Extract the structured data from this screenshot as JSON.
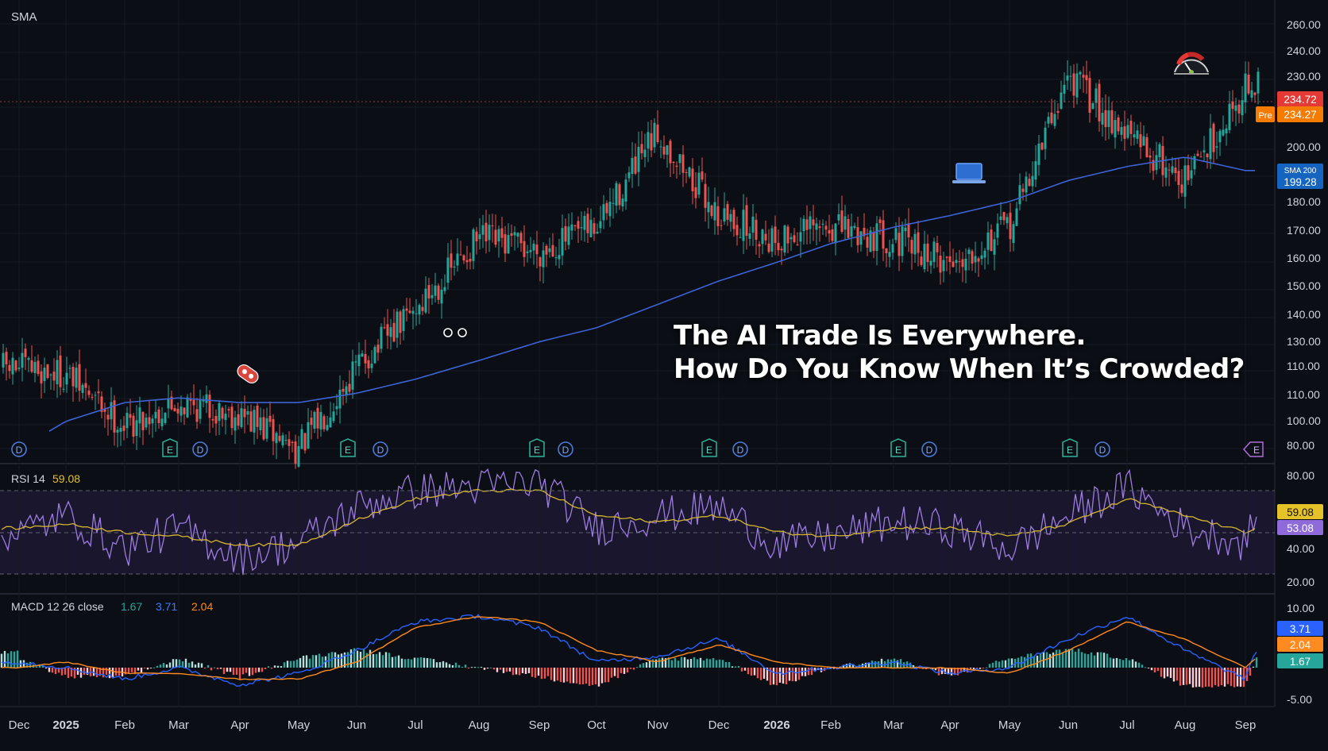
{
  "headline": {
    "line1": "The AI Trade Is Everywhere.",
    "line2": "How Do You Know When It’s Crowded?"
  },
  "price_pane": {
    "indicator_label": "SMA",
    "price_badge": "234.72",
    "pre_label": "Pre",
    "pre_badge": "234.27",
    "sma_label": "SMA 200",
    "sma_value": "199.28",
    "markers_d": [
      "D",
      "D",
      "D",
      "D",
      "D",
      "D",
      "D"
    ],
    "markers_e": [
      "E",
      "E",
      "E",
      "E",
      "E",
      "E",
      "E"
    ]
  },
  "rsi_pane": {
    "label": "RSI 14",
    "value": "59.08",
    "badge_rsi": "59.08",
    "badge_ma": "53.08"
  },
  "macd_pane": {
    "label": "MACD 12 26 close",
    "hist": "1.67",
    "macd": "3.71",
    "signal": "2.04",
    "badge_macd": "3.71",
    "badge_signal": "2.04",
    "badge_hist": "1.67"
  },
  "colors": {
    "background": "#0b0e14",
    "up": "#26a69a",
    "down": "#ef5350",
    "sma": "#3d63d6",
    "rsi": "#9c7de0",
    "rsi_ma": "#d4b530",
    "macd": "#2962ff",
    "signal": "#ff8a1f",
    "price_badge": "#e53935",
    "pre_badge": "#f57c00",
    "sma_badge": "#1565c0"
  },
  "icons": [
    "gauge-icon",
    "laptop-icon",
    "pill-icon"
  ],
  "chart_data": [
    {
      "type": "candlestick",
      "pane": "price",
      "x_axis": [
        "Dec",
        "2025",
        "Feb",
        "Mar",
        "Apr",
        "May",
        "Jun",
        "Jul",
        "Aug",
        "Sep",
        "Oct",
        "Nov",
        "Dec",
        "2026",
        "Feb",
        "Mar",
        "Apr",
        "May",
        "Jun",
        "Jul",
        "Aug",
        "Sep"
      ],
      "y_ticks": [
        "260.00",
        "240.00",
        "230.00",
        "200.00",
        "180.00",
        "170.00",
        "160.00",
        "150.00",
        "140.00",
        "130.00",
        "110.00",
        "110.00",
        "100.00",
        "80.00"
      ],
      "approx_close_by_month": [
        115,
        112,
        90,
        100,
        95,
        80,
        115,
        140,
        170,
        165,
        175,
        215,
        180,
        170,
        175,
        170,
        160,
        175,
        240,
        215,
        195,
        234.72
      ],
      "sma200_by_month": [
        80,
        92,
        100,
        102,
        100,
        100,
        104,
        110,
        118,
        126,
        132,
        142,
        152,
        160,
        168,
        175,
        180,
        186,
        195,
        201,
        205,
        199.28
      ]
    },
    {
      "type": "line",
      "pane": "rsi",
      "y_ticks": [
        "80.00",
        "40.00",
        "20.00"
      ],
      "bands": [
        70,
        30
      ],
      "series": [
        {
          "name": "RSI 14",
          "values": [
            50,
            58,
            42,
            52,
            38,
            45,
            62,
            70,
            72,
            74,
            52,
            58,
            62,
            44,
            48,
            55,
            52,
            42,
            58,
            72,
            52,
            45,
            59.08
          ]
        },
        {
          "name": "MA",
          "values": [
            52,
            54,
            50,
            48,
            44,
            44,
            56,
            66,
            70,
            70,
            58,
            55,
            58,
            50,
            48,
            52,
            52,
            48,
            54,
            66,
            58,
            50,
            53.08
          ]
        }
      ]
    },
    {
      "type": "line",
      "pane": "macd",
      "y_ticks": [
        "10.00",
        "-5.00"
      ],
      "series": [
        {
          "name": "MACD",
          "values": [
            1,
            0,
            -2,
            0,
            -3,
            -1,
            3,
            8,
            9,
            7,
            1,
            2,
            5,
            -1,
            0,
            1,
            -1,
            0,
            5,
            9,
            3,
            -2,
            3.71
          ]
        },
        {
          "name": "Signal",
          "values": [
            0,
            1,
            -1,
            -1,
            -2,
            -2,
            1,
            7,
            9,
            8,
            3,
            1,
            4,
            1,
            0,
            0,
            0,
            -1,
            3,
            8,
            5,
            0,
            2.04
          ]
        }
      ]
    }
  ]
}
